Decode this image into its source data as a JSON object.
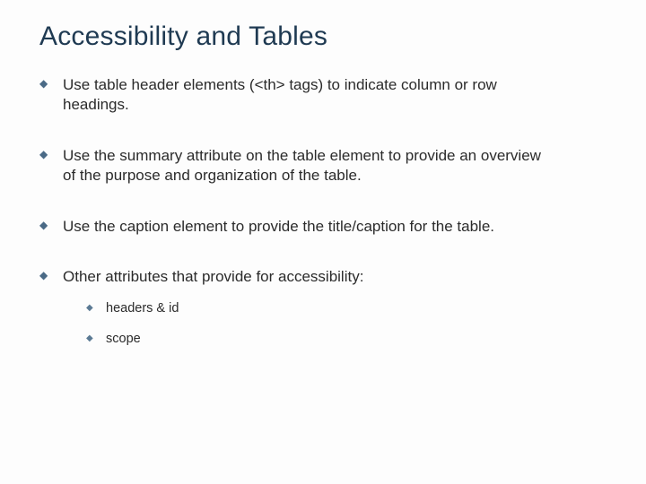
{
  "title": "Accessibility and Tables",
  "bullets": [
    {
      "text": "Use table header elements (<th> tags) to indicate column or row headings."
    },
    {
      "text": "Use the summary attribute on the table element to provide an overview of the purpose and organization of the table."
    },
    {
      "text": "Use the caption element to provide the title/caption for the table."
    },
    {
      "text": "Other attributes that provide for accessibility:",
      "sub": [
        {
          "text": "headers & id"
        },
        {
          "text": "scope"
        }
      ]
    }
  ]
}
